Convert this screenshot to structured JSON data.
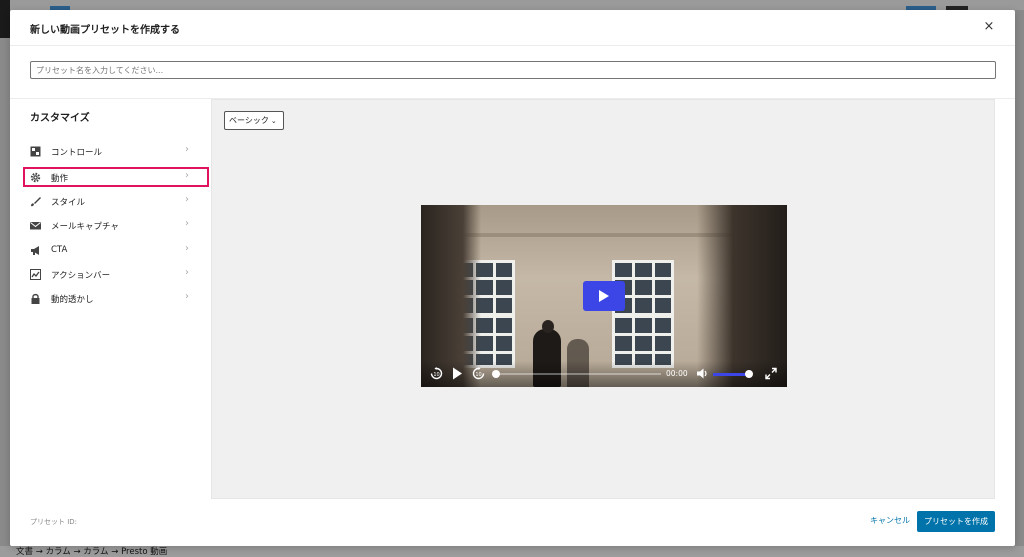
{
  "modal": {
    "title": "新しい動画プリセットを作成する",
    "close_icon": "×"
  },
  "preset_name": {
    "value": "",
    "placeholder": "プリセット名を入力してください..."
  },
  "sidebar": {
    "heading": "カスタマイズ",
    "items": [
      {
        "label": "コントロール",
        "icon": "controls-icon",
        "active": false
      },
      {
        "label": "動作",
        "icon": "gear-icon",
        "active": true
      },
      {
        "label": "スタイル",
        "icon": "brush-icon",
        "active": false
      },
      {
        "label": "メールキャプチャ",
        "icon": "mail-icon",
        "active": false
      },
      {
        "label": "CTA",
        "icon": "megaphone-icon",
        "active": false
      },
      {
        "label": "アクションバー",
        "icon": "chart-icon",
        "active": false
      },
      {
        "label": "動的透かし",
        "icon": "lock-icon",
        "active": false
      }
    ]
  },
  "preview": {
    "preset_select": "ベーシック",
    "player": {
      "time": "00:00",
      "progress": 0,
      "volume": 0.9,
      "accent_color": "#3c45e6"
    }
  },
  "footer": {
    "preset_id_label": "プリセット ID:",
    "cancel_label": "キャンセル",
    "create_label": "プリセットを作成"
  },
  "background": {
    "breadcrumb": "文書 → カラム → カラム → Presto 動画"
  },
  "colors": {
    "primary": "#0073aa",
    "highlight_border": "#e0135e"
  }
}
